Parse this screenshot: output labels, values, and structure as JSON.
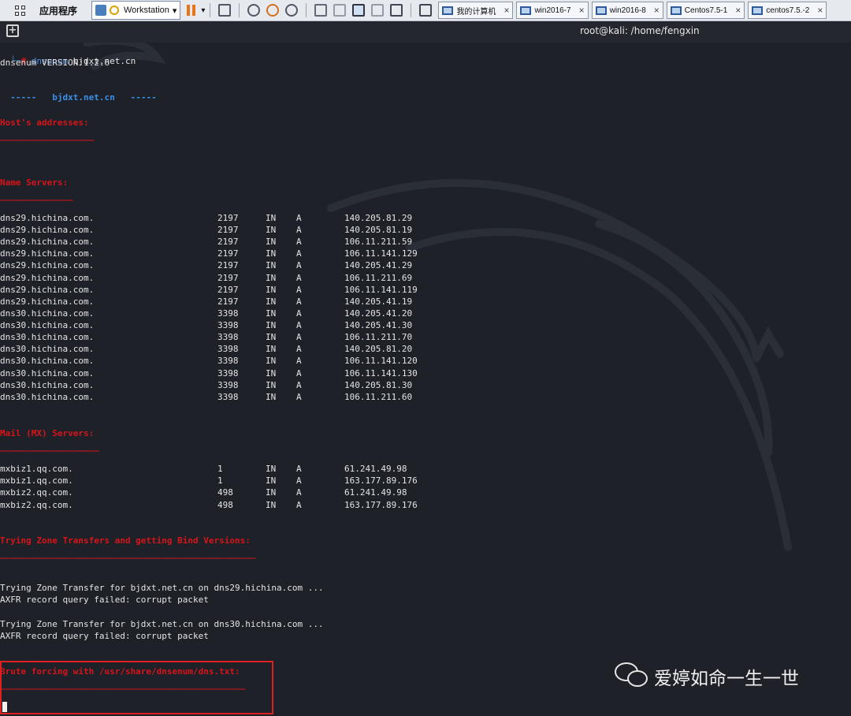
{
  "taskbar": {
    "apps_label": "应用程序",
    "workstation_label": "Workstation",
    "tabs": [
      {
        "label": "我的计算机"
      },
      {
        "label": "win2016-7"
      },
      {
        "label": "win2016-8"
      },
      {
        "label": "Centos7.5-1"
      },
      {
        "label": "centos7.5.-2"
      }
    ],
    "close_glyph": "×"
  },
  "terminal": {
    "title": "root@kali: /home/fengxin",
    "prompt_corner": "└─",
    "prompt_hash": "# ",
    "command_name": "dnsenum",
    "command_arg": " bjdxt.net.cn",
    "version_line": "dnsenum VERSION:1.2.6",
    "domain_banner_left": "-----   ",
    "domain_banner_domain": "bjdxt.net.cn",
    "domain_banner_right": "   -----",
    "host_heading": "Host's addresses:",
    "host_rule": "__________________",
    "ns_heading": "Name Servers:",
    "ns_rule": "______________",
    "name_servers": [
      {
        "host": "dns29.hichina.com.",
        "ttl": "2197",
        "class": "IN",
        "type": "A",
        "ip": "140.205.81.29"
      },
      {
        "host": "dns29.hichina.com.",
        "ttl": "2197",
        "class": "IN",
        "type": "A",
        "ip": "140.205.81.19"
      },
      {
        "host": "dns29.hichina.com.",
        "ttl": "2197",
        "class": "IN",
        "type": "A",
        "ip": "106.11.211.59"
      },
      {
        "host": "dns29.hichina.com.",
        "ttl": "2197",
        "class": "IN",
        "type": "A",
        "ip": "106.11.141.129"
      },
      {
        "host": "dns29.hichina.com.",
        "ttl": "2197",
        "class": "IN",
        "type": "A",
        "ip": "140.205.41.29"
      },
      {
        "host": "dns29.hichina.com.",
        "ttl": "2197",
        "class": "IN",
        "type": "A",
        "ip": "106.11.211.69"
      },
      {
        "host": "dns29.hichina.com.",
        "ttl": "2197",
        "class": "IN",
        "type": "A",
        "ip": "106.11.141.119"
      },
      {
        "host": "dns29.hichina.com.",
        "ttl": "2197",
        "class": "IN",
        "type": "A",
        "ip": "140.205.41.19"
      },
      {
        "host": "dns30.hichina.com.",
        "ttl": "3398",
        "class": "IN",
        "type": "A",
        "ip": "140.205.41.20"
      },
      {
        "host": "dns30.hichina.com.",
        "ttl": "3398",
        "class": "IN",
        "type": "A",
        "ip": "140.205.41.30"
      },
      {
        "host": "dns30.hichina.com.",
        "ttl": "3398",
        "class": "IN",
        "type": "A",
        "ip": "106.11.211.70"
      },
      {
        "host": "dns30.hichina.com.",
        "ttl": "3398",
        "class": "IN",
        "type": "A",
        "ip": "140.205.81.20"
      },
      {
        "host": "dns30.hichina.com.",
        "ttl": "3398",
        "class": "IN",
        "type": "A",
        "ip": "106.11.141.120"
      },
      {
        "host": "dns30.hichina.com.",
        "ttl": "3398",
        "class": "IN",
        "type": "A",
        "ip": "106.11.141.130"
      },
      {
        "host": "dns30.hichina.com.",
        "ttl": "3398",
        "class": "IN",
        "type": "A",
        "ip": "140.205.81.30"
      },
      {
        "host": "dns30.hichina.com.",
        "ttl": "3398",
        "class": "IN",
        "type": "A",
        "ip": "106.11.211.60"
      }
    ],
    "mx_heading": "Mail (MX) Servers:",
    "mx_rule": "___________________",
    "mx_servers": [
      {
        "host": "mxbiz1.qq.com.",
        "ttl": "1",
        "class": "IN",
        "type": "A",
        "ip": "61.241.49.98"
      },
      {
        "host": "mxbiz1.qq.com.",
        "ttl": "1",
        "class": "IN",
        "type": "A",
        "ip": "163.177.89.176"
      },
      {
        "host": "mxbiz2.qq.com.",
        "ttl": "498",
        "class": "IN",
        "type": "A",
        "ip": "61.241.49.98"
      },
      {
        "host": "mxbiz2.qq.com.",
        "ttl": "498",
        "class": "IN",
        "type": "A",
        "ip": "163.177.89.176"
      }
    ],
    "zt_heading": "Trying Zone Transfers and getting Bind Versions:",
    "zt_rule": "_________________________________________________",
    "zt_try1": "Trying Zone Transfer for bjdxt.net.cn on dns29.hichina.com ...",
    "zt_fail1": "AXFR record query failed: corrupt packet",
    "zt_try2": "Trying Zone Transfer for bjdxt.net.cn on dns30.hichina.com ...",
    "zt_fail2": "AXFR record query failed: corrupt packet",
    "brute_heading": "Brute forcing with /usr/share/dnsenum/dns.txt:",
    "brute_rule": "_______________________________________________"
  },
  "watermark": {
    "text": "爱婷如命一生一世",
    "icon": "wechat-icon"
  },
  "colors": {
    "background": "#1e2128",
    "heading_red": "#d8141b",
    "domain_blue": "#3a8fe8",
    "highlight_box": "#e02020"
  }
}
